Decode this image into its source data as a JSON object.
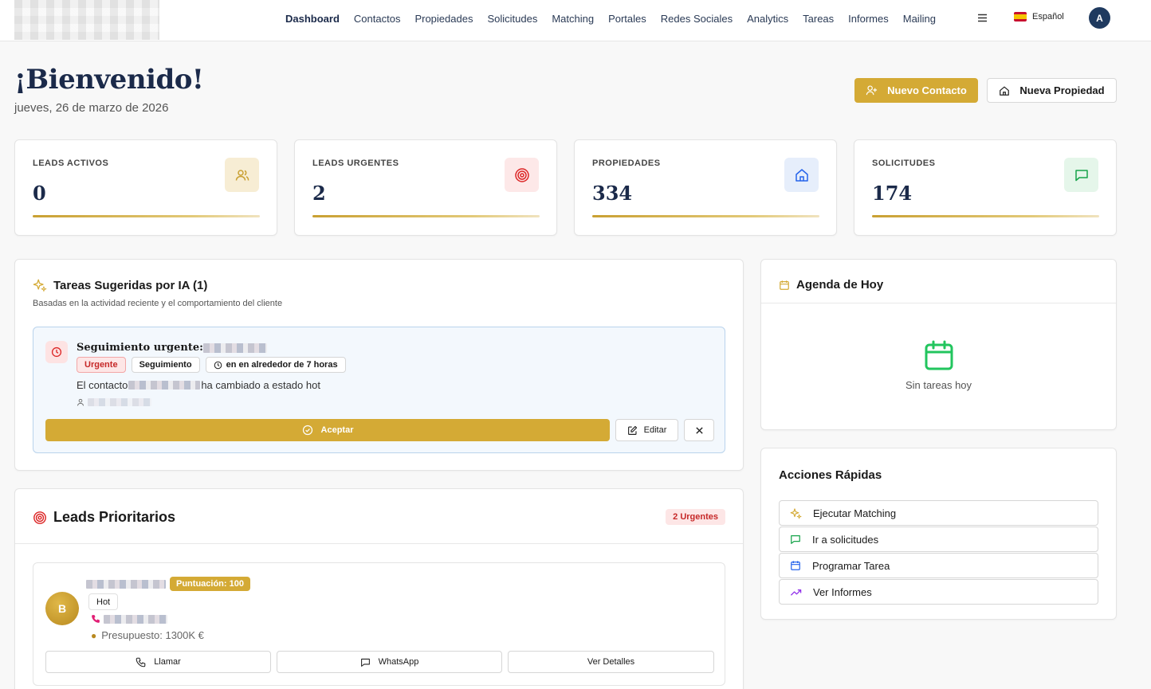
{
  "nav": {
    "items": [
      "Dashboard",
      "Contactos",
      "Propiedades",
      "Solicitudes",
      "Matching",
      "Portales",
      "Redes Sociales",
      "Analytics",
      "Tareas",
      "Informes",
      "Mailing"
    ],
    "language": "Español",
    "user_initial": "A"
  },
  "header": {
    "welcome": "¡Bienvenido!",
    "date": "jueves, 26 de marzo de 2026",
    "new_contact": "Nuevo Contacto",
    "new_property": "Nueva Propiedad"
  },
  "stats": [
    {
      "label": "LEADS ACTIVOS",
      "value": "0",
      "icon": "users-icon",
      "color": "#c9a032"
    },
    {
      "label": "LEADS URGENTES",
      "value": "2",
      "icon": "target-icon",
      "color": "#dc2626"
    },
    {
      "label": "PROPIEDADES",
      "value": "334",
      "icon": "home-icon",
      "color": "#2563eb"
    },
    {
      "label": "SOLICITUDES",
      "value": "174",
      "icon": "message-icon",
      "color": "#16a34a"
    }
  ],
  "ai_tasks": {
    "title": "Tareas Sugeridas por IA (1)",
    "subtitle": "Basadas en la actividad reciente y el comportamiento del cliente",
    "task": {
      "title": "Seguimiento urgente:",
      "badge_urgent": "Urgente",
      "badge_type": "Seguimiento",
      "badge_time": "en en alrededor de 7 horas",
      "desc_prefix": "El contacto",
      "desc_suffix": "ha cambiado a estado hot",
      "accept": "Aceptar",
      "edit": "Editar"
    }
  },
  "leads": {
    "title": "Leads Prioritarios",
    "badge": "2 Urgentes",
    "lead": {
      "initial": "B",
      "score": "Puntuación: 100",
      "status": "Hot",
      "budget": "Presupuesto: 1300K €",
      "call": "Llamar",
      "whatsapp": "WhatsApp",
      "details": "Ver Detalles"
    }
  },
  "agenda": {
    "title": "Agenda de Hoy",
    "empty": "Sin tareas hoy"
  },
  "quick_actions": {
    "title": "Acciones Rápidas",
    "items": [
      {
        "label": "Ejecutar Matching",
        "icon": "sparkle-icon",
        "color": "#d4aa35"
      },
      {
        "label": "Ir a solicitudes",
        "icon": "message-icon",
        "color": "#16a34a"
      },
      {
        "label": "Programar Tarea",
        "icon": "calendar-icon",
        "color": "#2563eb"
      },
      {
        "label": "Ver Informes",
        "icon": "trending-icon",
        "color": "#9333ea"
      }
    ]
  },
  "colors": {
    "accent": "#d4aa35",
    "navy": "#1b2a4a",
    "urgent": "#c62828"
  }
}
